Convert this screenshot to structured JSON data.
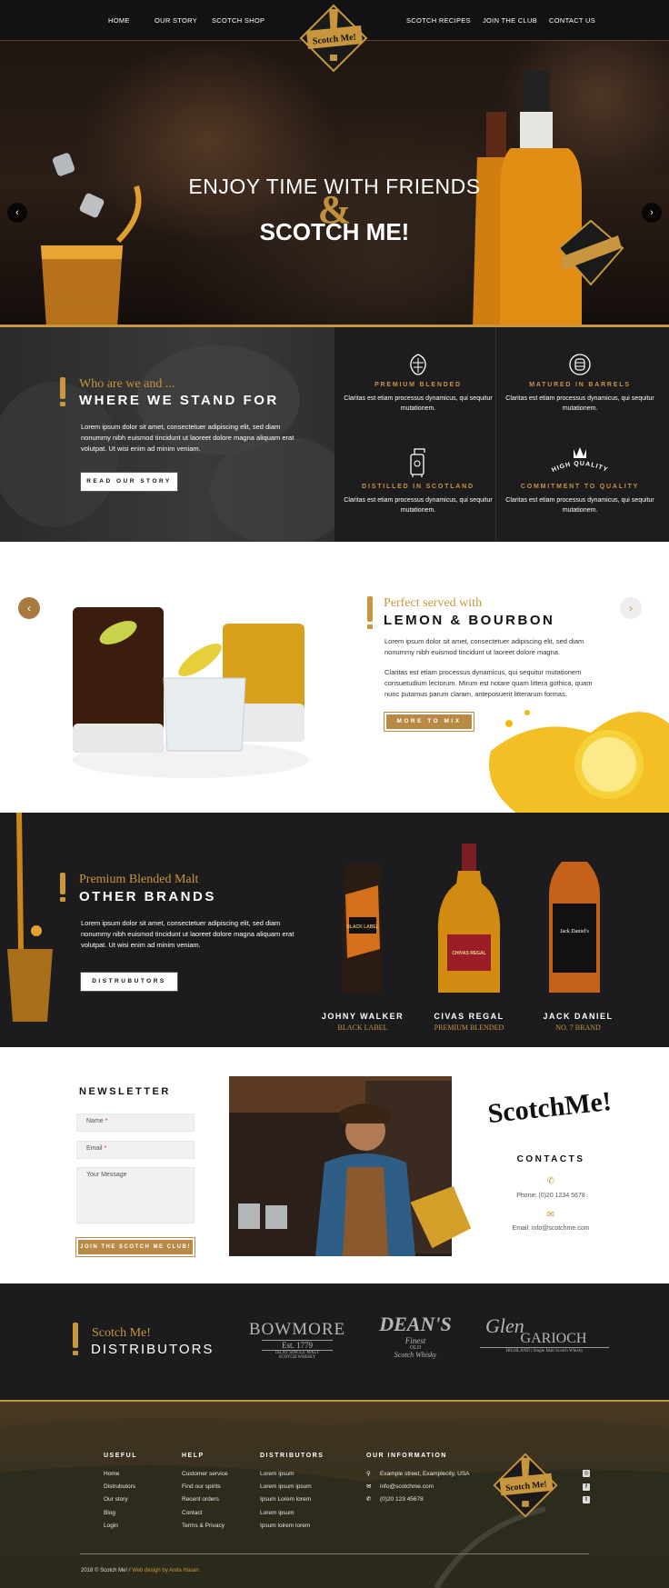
{
  "nav": {
    "items_left": [
      "HOME",
      "OUR STORY",
      "SCOTCH SHOP"
    ],
    "items_right": [
      "SCOTCH RECIPES",
      "JOIN THE CLUB",
      "CONTACT US"
    ],
    "logo_text": "Scotch Me!"
  },
  "hero": {
    "title_line1": "ENJOY TIME WITH FRIENDS",
    "ampersand": "&",
    "title_line2": "SCOTCH ME!",
    "prev_icon": "chevron-left-icon",
    "next_icon": "chevron-right-icon"
  },
  "stand": {
    "subtitle": "Who are we and ...",
    "title": "WHERE WE STAND FOR",
    "text": "Lorem ipsum dolor sit amet, consectetuer adipiscing elit, sed diam nonummy nibh euismod tincidunt ut laoreet dolore magna aliquam erat volutpat. Ut wisi enim ad minim veniam.",
    "button": "READ OUR STORY",
    "features": [
      {
        "icon": "hop-icon",
        "title": "PREMIUM BLENDED",
        "desc": "Claritas est etiam processus dynamicus, qui sequitur mutationem."
      },
      {
        "icon": "barrel-badge-icon",
        "title": "MATURED IN BARRELS",
        "desc": "Claritas est etiam processus dynamicus, qui sequitur mutationem."
      },
      {
        "icon": "still-icon",
        "title": "DISTILLED IN SCOTLAND",
        "desc": "Claritas est etiam processus dynamicus, qui sequitur mutationem."
      },
      {
        "icon": "crown-badge-icon",
        "title": "COMMITMENT TO QUALITY",
        "badge_text": "HIGH QUALITY",
        "desc": "Claritas est etiam processus dynamicus, qui sequitur mutationem."
      }
    ]
  },
  "lemon": {
    "subtitle": "Perfect served with",
    "title": "LEMON & BOURBON",
    "text1": "Lorem ipsum dolor sit amet, consectetuer adipiscing elit, sed diam nonummy nibh euismod tincidunt ut laoreet dolore magna.",
    "text2": "Claritas est etiam processus dynamicus, qui sequitur mutationem consuetudium lectorum. Mirum est notare quam littera gothica, quam nunc putamus parum claram, anteposuerit litterarum formas.",
    "button": "MORE TO MIX"
  },
  "brands": {
    "subtitle": "Premium Blended Malt",
    "title": "OTHER BRANDS",
    "text": "Lorem ipsum dolor sit amet, consectetuer adipiscing elit, sed diam nonummy nibh euismod tincidunt ut laoreet dolore magna aliquam erat volutpat. Ut wisi enim ad minim veniam.",
    "button": "DISTRUBUTORS",
    "bottles": [
      {
        "name": "JOHNY WALKER",
        "sub": "BLACK LABEL",
        "label": "BLACK LABEL"
      },
      {
        "name": "CIVAS REGAL",
        "sub": "PREMIUM BLENDED",
        "label": "CHIVAS REGAL"
      },
      {
        "name": "JACK DANIEL",
        "sub": "NO. 7 BRAND",
        "label": "Jack Daniel's"
      }
    ]
  },
  "newsletter": {
    "title": "NEWSLETTER",
    "name_ph": "Name",
    "email_ph": "Email",
    "message_ph": "Your Message",
    "button": "JOIN THE SCOTCH ME CLUB!",
    "logo_text": "ScotchMe!",
    "contacts_title": "CONTACTS",
    "phone": "Phone:  (0)20 1234 5678",
    "email": "Email: info@scotchme.com"
  },
  "distributors": {
    "subtitle": "Scotch Me!",
    "title": "DISTRIBUTORS",
    "logos": [
      {
        "name": "BOWMORE",
        "line2": "Est. 1779",
        "line3": "ISLAY SINGLE MALT",
        "line4": "SCOTCH WHISKY"
      },
      {
        "name": "DEAN'S",
        "line2": "Finest",
        "line3": "OLD",
        "line4": "Scotch Whisky"
      },
      {
        "name": "Glen",
        "line2": "GARIOCH",
        "line3": "HIGHLAND | Single Malt Scotch Whisky"
      }
    ]
  },
  "footer": {
    "useful": {
      "title": "USEFUL",
      "links": [
        "Home",
        "Distrubutors",
        "Our story",
        "Blog",
        "Login"
      ]
    },
    "help": {
      "title": "HELP",
      "links": [
        "Customer service",
        "Find our spirits",
        "Recent orders",
        "Contact",
        "Terms & Privacy"
      ]
    },
    "distributors": {
      "title": "DISTRIBUTORS",
      "links": [
        "Lorem ipsum",
        "Lorem ipsum ipsum",
        "Ipsum Lorem lorem",
        "Lorem ipsum",
        "Ipsum loirem lorem"
      ]
    },
    "info": {
      "title": "OUR INFORMATION",
      "address": "Example street, Examplecity, USA",
      "email": "info@scotchme.com",
      "phone": "(0)20 123 45678"
    },
    "copyright": "2018 © Scotch Me!  /",
    "credit": "Web design by Anita Hasan"
  }
}
